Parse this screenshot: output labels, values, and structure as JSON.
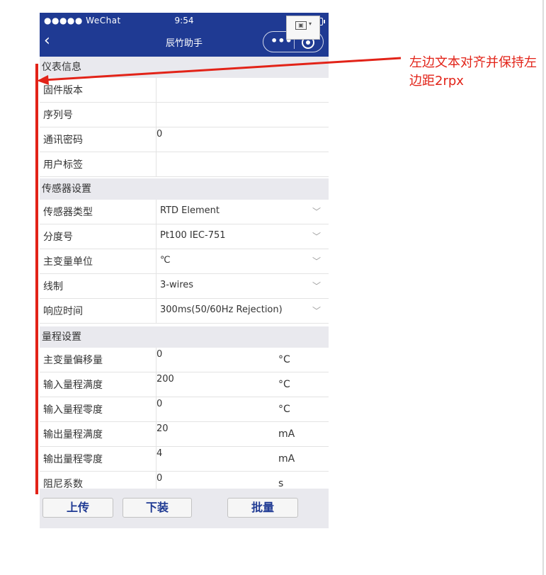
{
  "status_bar": {
    "carrier": "●●●●● WeChat",
    "time": "9:54"
  },
  "nav": {
    "title": "辰竹助手",
    "back_icon": "‹",
    "more_icon": "•••"
  },
  "sections": {
    "instrument": {
      "title": "仪表信息",
      "rows": [
        {
          "label": "固件版本",
          "value": ""
        },
        {
          "label": "序列号",
          "value": ""
        },
        {
          "label": "通讯密码",
          "value": "0"
        },
        {
          "label": "用户标签",
          "value": ""
        }
      ]
    },
    "sensor": {
      "title": "传感器设置",
      "rows": [
        {
          "label": "传感器类型",
          "value": "RTD Element"
        },
        {
          "label": "分度号",
          "value": "Pt100 IEC-751"
        },
        {
          "label": "主变量单位",
          "value": "℃"
        },
        {
          "label": "线制",
          "value": "3-wires"
        },
        {
          "label": "响应时间",
          "value": "300ms(50/60Hz Rejection)"
        }
      ]
    },
    "range": {
      "title": "量程设置",
      "rows": [
        {
          "label": "主变量偏移量",
          "value": "0",
          "unit": "°C"
        },
        {
          "label": "输入量程满度",
          "value": "200",
          "unit": "°C"
        },
        {
          "label": "输入量程零度",
          "value": "0",
          "unit": "°C"
        },
        {
          "label": "输出量程满度",
          "value": "20",
          "unit": "mA"
        },
        {
          "label": "输出量程零度",
          "value": "4",
          "unit": "mA"
        },
        {
          "label": "阻尼系数",
          "value": "0",
          "unit": "s"
        }
      ]
    }
  },
  "buttons": {
    "upload": "上传",
    "download": "下装",
    "batch": "批量"
  },
  "annotation": {
    "text": "左边文本对齐并保持左边距2rpx",
    "color": "#e22318"
  },
  "colors": {
    "nav_bg": "#1f3a93",
    "section_bg": "#e9e9ee",
    "button_text": "#1f3a93"
  }
}
